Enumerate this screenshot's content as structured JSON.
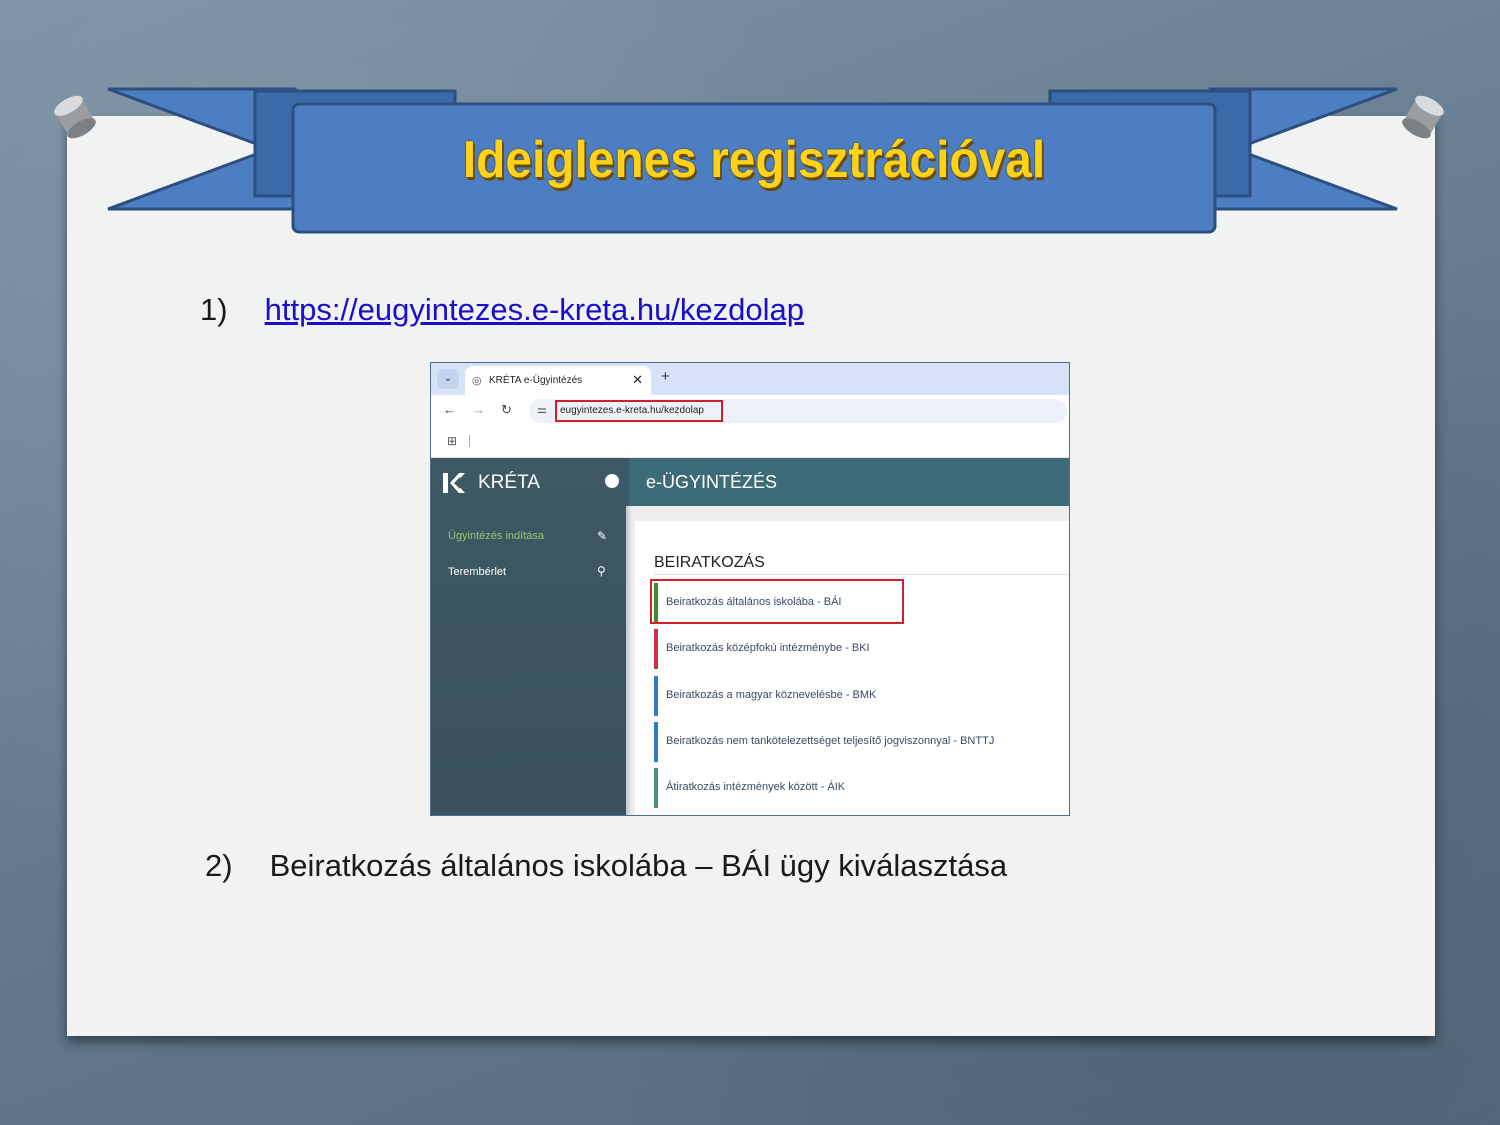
{
  "slide": {
    "title": "Ideiglenes regisztrációval",
    "step1": {
      "number": "1)",
      "link_text": "https://eugyintezes.e-kreta.hu/kezdolap"
    },
    "step2": {
      "number": "2)",
      "text": "Beiratkozás általános iskolába – BÁI ügy kiválasztása"
    },
    "colors": {
      "background": "#6d8496",
      "paper": "#f1f2f2",
      "banner": "#4d7ec1",
      "title": "#ffd21a",
      "link": "#1a0dcc"
    }
  },
  "browser": {
    "tab_title": "KRÉTA e-Ügyintézés",
    "tab_close": "✕",
    "new_tab": "+",
    "url": "eugyintezes.e-kreta.hu/kezdolap",
    "icons": [
      "chevron-down-icon",
      "globe-icon",
      "back-icon",
      "forward-icon",
      "reload-icon",
      "tune-icon",
      "apps-icon"
    ]
  },
  "app": {
    "brand": "KRÉTA",
    "header_title": "e-ÜGYINTÉZÉS",
    "sidebar": [
      {
        "label": "Ügyintézés indítása",
        "icon": "edit-note-icon",
        "active": true
      },
      {
        "label": "Terembérlet",
        "icon": "search-icon",
        "active": false
      }
    ],
    "section_title": "BEIRATKOZÁS",
    "items": [
      {
        "label": "Beiratkozás általános iskolába - BÁI",
        "color": "#3f8a2a",
        "highlighted": true
      },
      {
        "label": "Beiratkozás középfokú intézménybe - BKI",
        "color": "#d0303a"
      },
      {
        "label": "Beiratkozás a magyar köznevelésbe - BMK",
        "color": "#2f7ad0"
      },
      {
        "label": "Beiratkozás nem tankötelezettséget teljesítő jogviszonnyal - BNTTJ",
        "color": "#2f7ad0"
      },
      {
        "label": "Átiratkozás intézmények között - ÁIK",
        "color": "#4f8f7a"
      }
    ]
  }
}
